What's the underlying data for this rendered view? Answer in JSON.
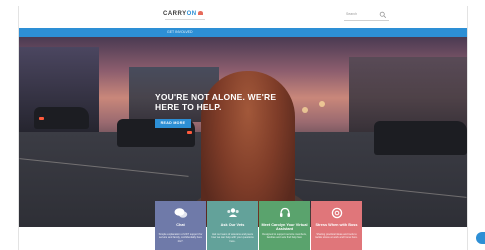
{
  "header": {
    "logo_main": "CARRY",
    "logo_accent": "ON",
    "search_placeholder": "Search"
  },
  "nav": {
    "items": [
      "GET INVOLVED"
    ]
  },
  "hero": {
    "headline_line1": "YOU'RE NOT ALONE. WE'RE",
    "headline_line2": "HERE TO HELP.",
    "button_label": "READ MORE"
  },
  "cards": [
    {
      "title": "Chat",
      "desc": "Simple explanation of 24/7 support for service and family, confidentially here 24/7.",
      "color": "#6f7aa9",
      "icon": "chat-bubbles-icon"
    },
    {
      "title": "Ask Our Vets",
      "desc": "Ask our team of veterans and peers how we can help with your questions here.",
      "color": "#63a29a",
      "icon": "people-icon"
    },
    {
      "title": "Meet Carolyn Your Virtual Assistant",
      "desc": "Designed to support service members, families and vets find help fast.",
      "color": "#5aa36d",
      "icon": "headset-icon"
    },
    {
      "title": "Stress When with Boss",
      "desc": "Sharing practical ideas and tools to tackle stress at work and home here.",
      "color": "#e0767a",
      "icon": "lifebuoy-icon"
    }
  ],
  "colors": {
    "brand_blue": "#2d8fd5",
    "logo_accent": "#2b8fd6"
  }
}
